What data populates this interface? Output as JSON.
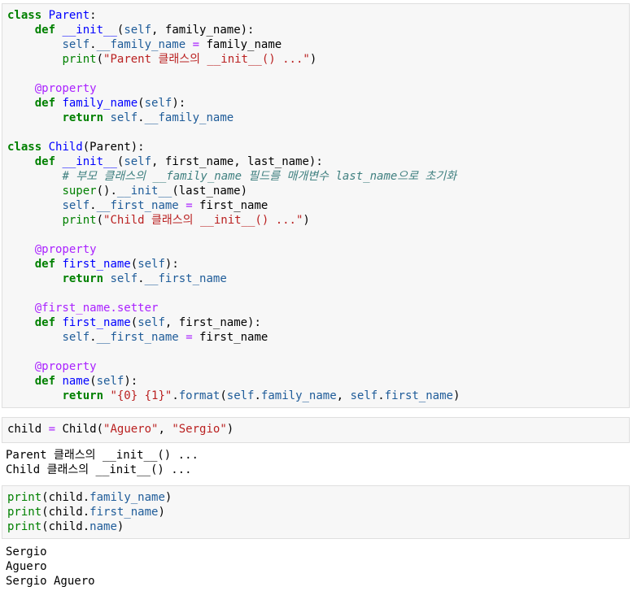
{
  "cells": [
    {
      "lines": [
        [
          [
            "kw",
            "class"
          ],
          [
            "t",
            " "
          ],
          [
            "cls",
            "Parent"
          ],
          [
            "t",
            ":"
          ]
        ],
        [
          [
            "t",
            "    "
          ],
          [
            "kw",
            "def"
          ],
          [
            "t",
            " "
          ],
          [
            "fn",
            "__init__"
          ],
          [
            "t",
            "("
          ],
          [
            "sf",
            "self"
          ],
          [
            "t",
            ", family_name):"
          ]
        ],
        [
          [
            "t",
            "        "
          ],
          [
            "sf",
            "self"
          ],
          [
            "t",
            "."
          ],
          [
            "attr",
            "__family_name"
          ],
          [
            "t",
            " "
          ],
          [
            "op",
            "="
          ],
          [
            "t",
            " family_name"
          ]
        ],
        [
          [
            "t",
            "        "
          ],
          [
            "bi",
            "print"
          ],
          [
            "t",
            "("
          ],
          [
            "str",
            "\"Parent 클래스의 __init__() ...\""
          ],
          [
            "t",
            ")"
          ]
        ],
        [
          [
            "t",
            ""
          ]
        ],
        [
          [
            "t",
            "    "
          ],
          [
            "dec",
            "@property"
          ]
        ],
        [
          [
            "t",
            "    "
          ],
          [
            "kw",
            "def"
          ],
          [
            "t",
            " "
          ],
          [
            "fn",
            "family_name"
          ],
          [
            "t",
            "("
          ],
          [
            "sf",
            "self"
          ],
          [
            "t",
            "):"
          ]
        ],
        [
          [
            "t",
            "        "
          ],
          [
            "kw",
            "return"
          ],
          [
            "t",
            " "
          ],
          [
            "sf",
            "self"
          ],
          [
            "t",
            "."
          ],
          [
            "attr",
            "__family_name"
          ]
        ],
        [
          [
            "t",
            ""
          ]
        ],
        [
          [
            "kw",
            "class"
          ],
          [
            "t",
            " "
          ],
          [
            "cls",
            "Child"
          ],
          [
            "t",
            "(Parent):"
          ]
        ],
        [
          [
            "t",
            "    "
          ],
          [
            "kw",
            "def"
          ],
          [
            "t",
            " "
          ],
          [
            "fn",
            "__init__"
          ],
          [
            "t",
            "("
          ],
          [
            "sf",
            "self"
          ],
          [
            "t",
            ", first_name, last_name):"
          ]
        ],
        [
          [
            "t",
            "        "
          ],
          [
            "cm",
            "# 부모 클래스의 __family_name 필드를 매개변수 last_name으로 초기화"
          ]
        ],
        [
          [
            "t",
            "        "
          ],
          [
            "bi",
            "super"
          ],
          [
            "t",
            "()."
          ],
          [
            "attr",
            "__init__"
          ],
          [
            "t",
            "(last_name)"
          ]
        ],
        [
          [
            "t",
            "        "
          ],
          [
            "sf",
            "self"
          ],
          [
            "t",
            "."
          ],
          [
            "attr",
            "__first_name"
          ],
          [
            "t",
            " "
          ],
          [
            "op",
            "="
          ],
          [
            "t",
            " first_name"
          ]
        ],
        [
          [
            "t",
            "        "
          ],
          [
            "bi",
            "print"
          ],
          [
            "t",
            "("
          ],
          [
            "str",
            "\"Child 클래스의 __init__() ...\""
          ],
          [
            "t",
            ")"
          ]
        ],
        [
          [
            "t",
            ""
          ]
        ],
        [
          [
            "t",
            "    "
          ],
          [
            "dec",
            "@property"
          ]
        ],
        [
          [
            "t",
            "    "
          ],
          [
            "kw",
            "def"
          ],
          [
            "t",
            " "
          ],
          [
            "fn",
            "first_name"
          ],
          [
            "t",
            "("
          ],
          [
            "sf",
            "self"
          ],
          [
            "t",
            "):"
          ]
        ],
        [
          [
            "t",
            "        "
          ],
          [
            "kw",
            "return"
          ],
          [
            "t",
            " "
          ],
          [
            "sf",
            "self"
          ],
          [
            "t",
            "."
          ],
          [
            "attr",
            "__first_name"
          ]
        ],
        [
          [
            "t",
            ""
          ]
        ],
        [
          [
            "t",
            "    "
          ],
          [
            "dec",
            "@first_name.setter"
          ]
        ],
        [
          [
            "t",
            "    "
          ],
          [
            "kw",
            "def"
          ],
          [
            "t",
            " "
          ],
          [
            "fn",
            "first_name"
          ],
          [
            "t",
            "("
          ],
          [
            "sf",
            "self"
          ],
          [
            "t",
            ", first_name):"
          ]
        ],
        [
          [
            "t",
            "        "
          ],
          [
            "sf",
            "self"
          ],
          [
            "t",
            "."
          ],
          [
            "attr",
            "__first_name"
          ],
          [
            "t",
            " "
          ],
          [
            "op",
            "="
          ],
          [
            "t",
            " first_name"
          ]
        ],
        [
          [
            "t",
            ""
          ]
        ],
        [
          [
            "t",
            "    "
          ],
          [
            "dec",
            "@property"
          ]
        ],
        [
          [
            "t",
            "    "
          ],
          [
            "kw",
            "def"
          ],
          [
            "t",
            " "
          ],
          [
            "fn",
            "name"
          ],
          [
            "t",
            "("
          ],
          [
            "sf",
            "self"
          ],
          [
            "t",
            "):"
          ]
        ],
        [
          [
            "t",
            "        "
          ],
          [
            "kw",
            "return"
          ],
          [
            "t",
            " "
          ],
          [
            "str",
            "\"{0} {1}\""
          ],
          [
            "t",
            "."
          ],
          [
            "attr",
            "format"
          ],
          [
            "t",
            "("
          ],
          [
            "sf",
            "self"
          ],
          [
            "t",
            "."
          ],
          [
            "attr",
            "family_name"
          ],
          [
            "t",
            ", "
          ],
          [
            "sf",
            "self"
          ],
          [
            "t",
            "."
          ],
          [
            "attr",
            "first_name"
          ],
          [
            "t",
            ")"
          ]
        ]
      ]
    },
    {
      "lines": [
        [
          [
            "t",
            "child "
          ],
          [
            "op",
            "="
          ],
          [
            "t",
            " Child("
          ],
          [
            "str",
            "\"Aguero\""
          ],
          [
            "t",
            ", "
          ],
          [
            "str",
            "\"Sergio\""
          ],
          [
            "t",
            ")"
          ]
        ]
      ]
    },
    {
      "lines": [
        [
          [
            "bi",
            "print"
          ],
          [
            "t",
            "(child."
          ],
          [
            "attr",
            "family_name"
          ],
          [
            "t",
            ")"
          ]
        ],
        [
          [
            "bi",
            "print"
          ],
          [
            "t",
            "(child."
          ],
          [
            "attr",
            "first_name"
          ],
          [
            "t",
            ")"
          ]
        ],
        [
          [
            "bi",
            "print"
          ],
          [
            "t",
            "(child."
          ],
          [
            "attr",
            "name"
          ],
          [
            "t",
            ")"
          ]
        ]
      ]
    }
  ],
  "outputs": [
    "Parent 클래스의 __init__() ...\nChild 클래스의 __init__() ...",
    "Sergio\nAguero\nSergio Aguero"
  ]
}
